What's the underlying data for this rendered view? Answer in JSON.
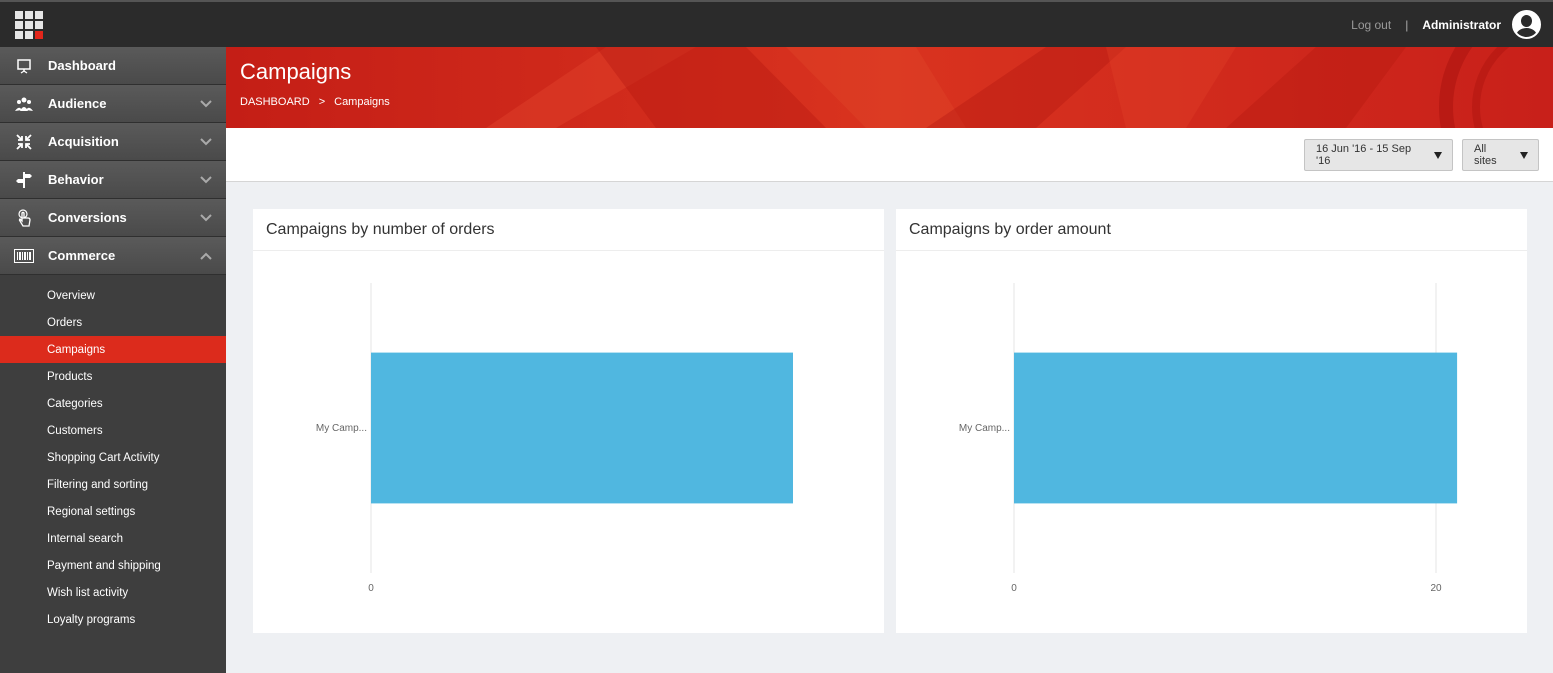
{
  "topbar": {
    "logout_label": "Log out",
    "separator": "|",
    "user_name": "Administrator"
  },
  "sidebar": {
    "items": [
      {
        "label": "Dashboard",
        "icon": "presentation-icon",
        "chevron": "none"
      },
      {
        "label": "Audience",
        "icon": "people-icon",
        "chevron": "down"
      },
      {
        "label": "Acquisition",
        "icon": "arrows-in-icon",
        "chevron": "down"
      },
      {
        "label": "Behavior",
        "icon": "signpost-icon",
        "chevron": "down"
      },
      {
        "label": "Conversions",
        "icon": "hand-pointer-icon",
        "chevron": "down"
      },
      {
        "label": "Commerce",
        "icon": "barcode-icon",
        "chevron": "up"
      }
    ],
    "sub_items": [
      {
        "label": "Overview",
        "active": false
      },
      {
        "label": "Orders",
        "active": false
      },
      {
        "label": "Campaigns",
        "active": true
      },
      {
        "label": "Products",
        "active": false
      },
      {
        "label": "Categories",
        "active": false
      },
      {
        "label": "Customers",
        "active": false
      },
      {
        "label": "Shopping Cart Activity",
        "active": false
      },
      {
        "label": "Filtering and sorting",
        "active": false
      },
      {
        "label": "Regional settings",
        "active": false
      },
      {
        "label": "Internal search",
        "active": false
      },
      {
        "label": "Payment and shipping",
        "active": false
      },
      {
        "label": "Wish list activity",
        "active": false
      },
      {
        "label": "Loyalty programs",
        "active": false
      }
    ]
  },
  "header": {
    "title": "Campaigns",
    "breadcrumb": [
      "DASHBOARD",
      "Campaigns"
    ],
    "breadcrumb_separator": ">"
  },
  "toolbar": {
    "date_range": "16 Jun '16 - 15 Sep '16",
    "site_filter": "All sites"
  },
  "colors": {
    "accent": "#dc2b1c",
    "bar": "#50b7e0",
    "sidebar": "#3e3e3e",
    "topbar": "#2b2b2b"
  },
  "chart_data": [
    {
      "type": "bar",
      "orientation": "horizontal",
      "title": "Campaigns by number of orders",
      "categories": [
        "My Camp..."
      ],
      "values": [
        1
      ],
      "xlim": [
        0,
        1
      ],
      "x_ticks": [
        {
          "value": 0,
          "label": "0"
        }
      ],
      "grid": false
    },
    {
      "type": "bar",
      "orientation": "horizontal",
      "title": "Campaigns by order amount",
      "categories": [
        "My Camp..."
      ],
      "values": [
        21
      ],
      "xlim": [
        0,
        20
      ],
      "x_ticks": [
        {
          "value": 0,
          "label": "0"
        },
        {
          "value": 20,
          "label": "20"
        }
      ],
      "grid": true
    }
  ]
}
